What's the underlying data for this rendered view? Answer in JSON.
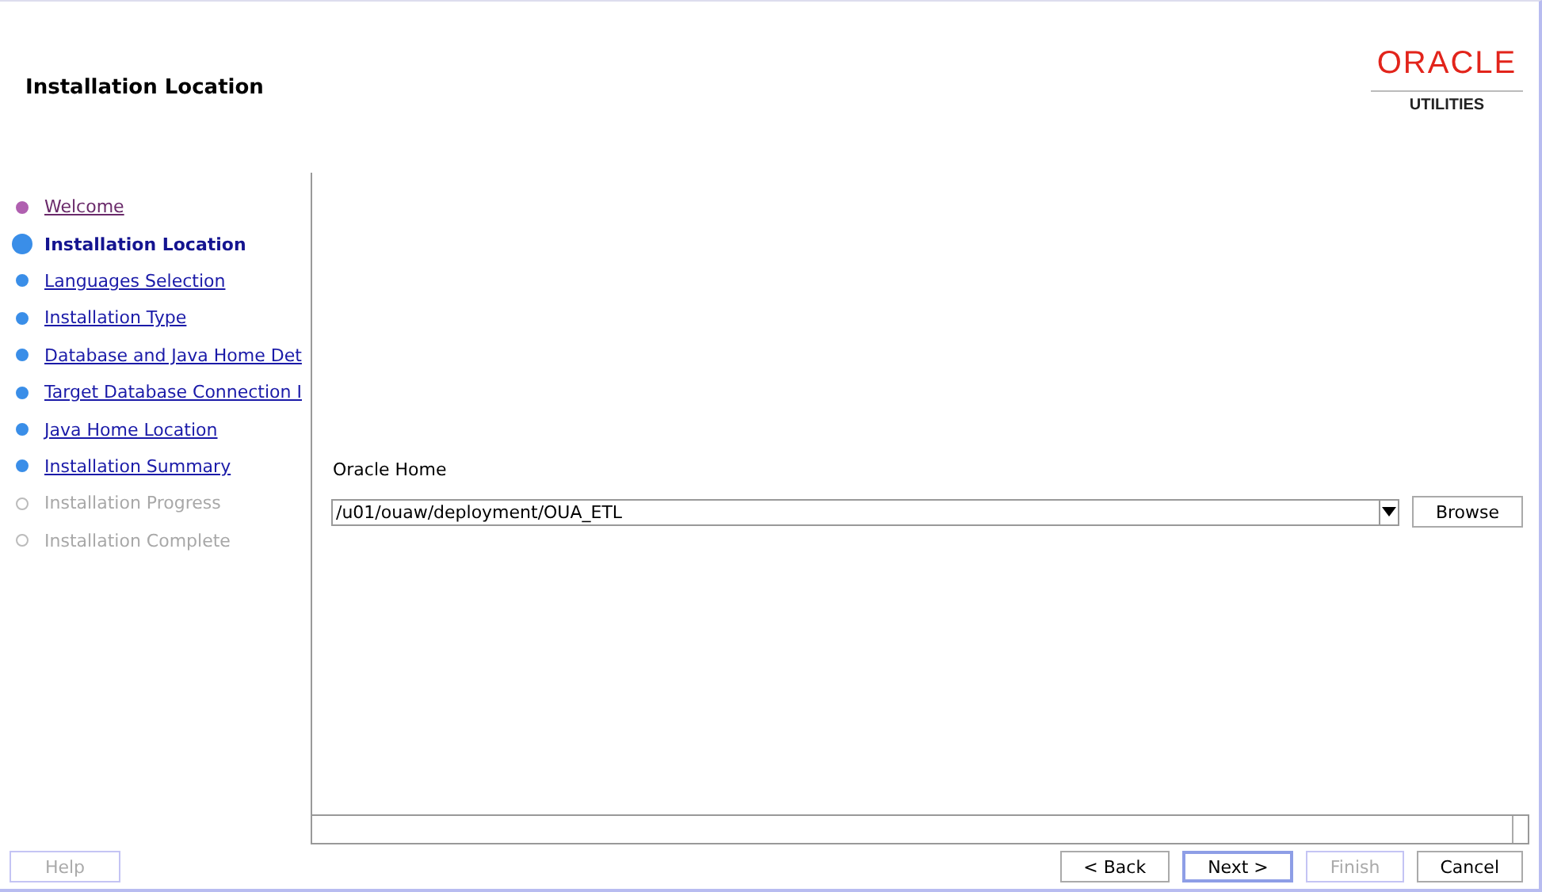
{
  "header": {
    "title": "Installation Location",
    "logo": {
      "brand": "ORACLE",
      "product": "UTILITIES"
    }
  },
  "steps": [
    {
      "label": "Welcome",
      "kind": "visited"
    },
    {
      "label": "Installation Location",
      "kind": "current"
    },
    {
      "label": "Languages Selection",
      "kind": "link"
    },
    {
      "label": "Installation Type",
      "kind": "link"
    },
    {
      "label": "Database and Java Home Det",
      "kind": "link"
    },
    {
      "label": "Target Database Connection I",
      "kind": "link"
    },
    {
      "label": "Java Home Location",
      "kind": "link"
    },
    {
      "label": "Installation Summary",
      "kind": "link"
    },
    {
      "label": "Installation Progress",
      "kind": "disabled"
    },
    {
      "label": "Installation Complete",
      "kind": "disabled"
    }
  ],
  "oracle_home": {
    "label": "Oracle Home",
    "value": "/u01/ouaw/deployment/OUA_ETL",
    "browse": "Browse"
  },
  "footer": {
    "help": {
      "label": "Help",
      "disabled": true
    },
    "buttons": [
      {
        "label": "< Back",
        "disabled": false,
        "selected": false
      },
      {
        "label": "Next >",
        "disabled": false,
        "selected": true
      },
      {
        "label": "Finish",
        "disabled": true,
        "selected": false
      },
      {
        "label": "Cancel",
        "disabled": false,
        "selected": false
      }
    ]
  }
}
